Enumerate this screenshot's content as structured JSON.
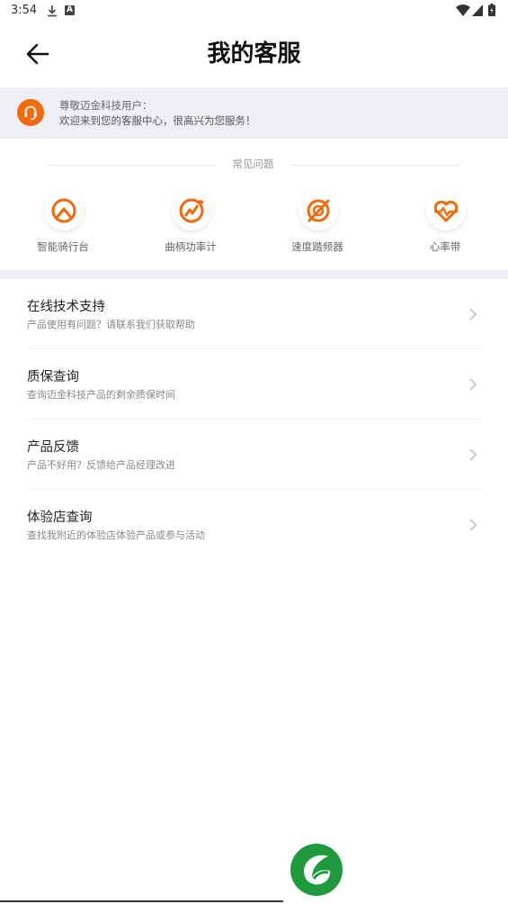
{
  "status_bar": {
    "time": "3:54",
    "a_glyph": "A"
  },
  "header": {
    "title": "我的客服",
    "back_icon": "arrow-left-icon"
  },
  "welcome": {
    "line1": "尊敬迈金科技用户：",
    "line2": "欢迎来到您的客服中心，很高兴为您服务！",
    "avatar_icon": "headset-icon",
    "accent": "#f26a0b"
  },
  "faq": {
    "title": "常见问题",
    "items": [
      {
        "label": "智能骑行台",
        "icon": "smart-trainer-icon"
      },
      {
        "label": "曲柄功率计",
        "icon": "crank-power-meter-icon"
      },
      {
        "label": "速度踏频器",
        "icon": "speed-cadence-sensor-icon"
      },
      {
        "label": "心率带",
        "icon": "heart-rate-strap-icon"
      }
    ]
  },
  "menu": [
    {
      "title": "在线技术支持",
      "subtitle": "产品使用有问题？请联系我们获取帮助"
    },
    {
      "title": "质保查询",
      "subtitle": "查询迈金科技产品的剩余质保时间"
    },
    {
      "title": "产品反馈",
      "subtitle": "产品不好用？反馈给产品经理改进"
    },
    {
      "title": "体验店查询",
      "subtitle": "查找我附近的体验店体验产品或参与活动"
    }
  ],
  "colors": {
    "orange": "#f26a0b",
    "band": "#eeeef4",
    "logo_green": "#1e9a3c"
  }
}
